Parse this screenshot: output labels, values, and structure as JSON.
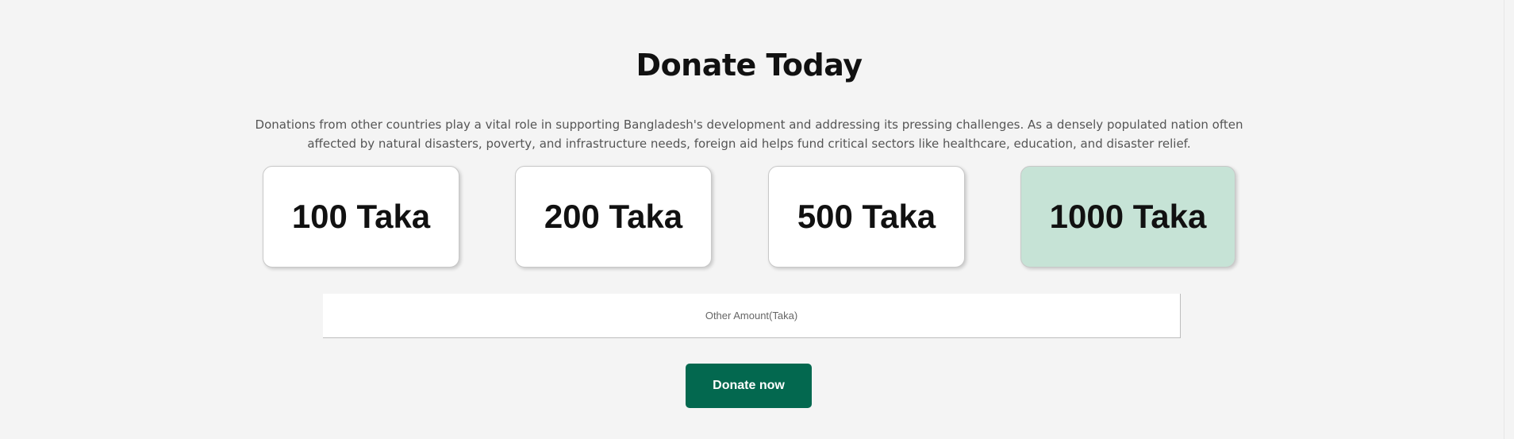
{
  "section": {
    "title": "Donate Today",
    "description": "Donations from other countries play a vital role in supporting Bangladesh's development and addressing its pressing challenges. As a densely populated nation often affected by natural disasters, poverty, and infrastructure needs, foreign aid helps fund critical sectors like healthcare, education, and disaster relief."
  },
  "amounts": [
    {
      "label": "100 Taka",
      "selected": false
    },
    {
      "label": "200 Taka",
      "selected": false
    },
    {
      "label": "500 Taka",
      "selected": false
    },
    {
      "label": "1000 Taka",
      "selected": true
    }
  ],
  "other_amount": {
    "placeholder": "Other Amount(Taka)",
    "value": ""
  },
  "donate_button": {
    "label": "Donate now"
  },
  "colors": {
    "background": "#f4f4f4",
    "accent": "#03684f",
    "selected_card": "#c6e3d6"
  }
}
